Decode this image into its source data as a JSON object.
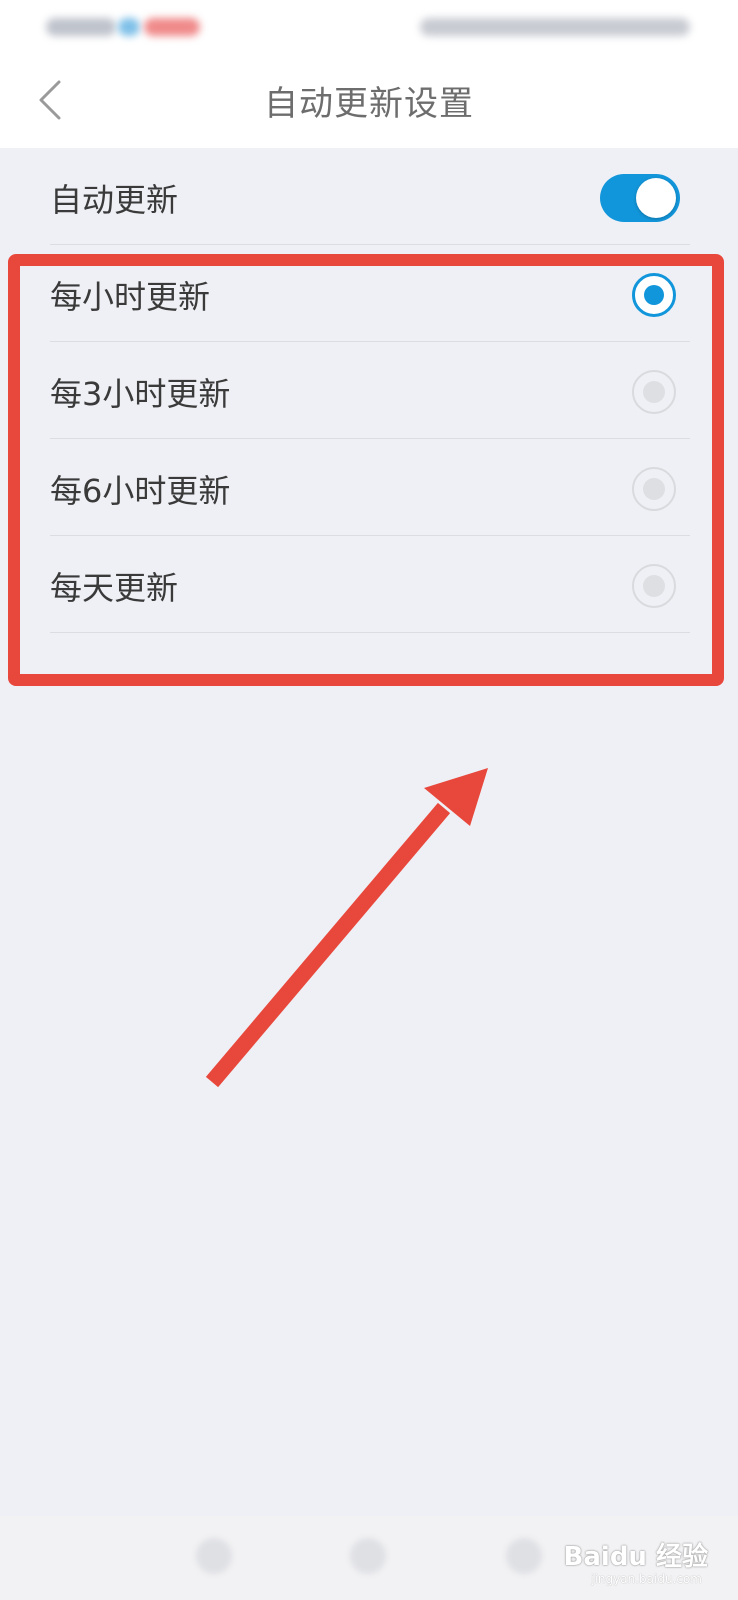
{
  "header": {
    "title": "自动更新设置"
  },
  "auto_update": {
    "label": "自动更新",
    "enabled": true
  },
  "options": [
    {
      "label": "每小时更新",
      "selected": true
    },
    {
      "label": "每3小时更新",
      "selected": false
    },
    {
      "label": "每6小时更新",
      "selected": false
    },
    {
      "label": "每天更新",
      "selected": false
    }
  ],
  "watermark": {
    "brand": "Baidu 经验",
    "url": "jingyan.baidu.com"
  },
  "colors": {
    "accent": "#1296db",
    "annotation": "#e8473b",
    "background": "#eff0f5"
  },
  "icons": {
    "back": "chevron-left-icon"
  }
}
